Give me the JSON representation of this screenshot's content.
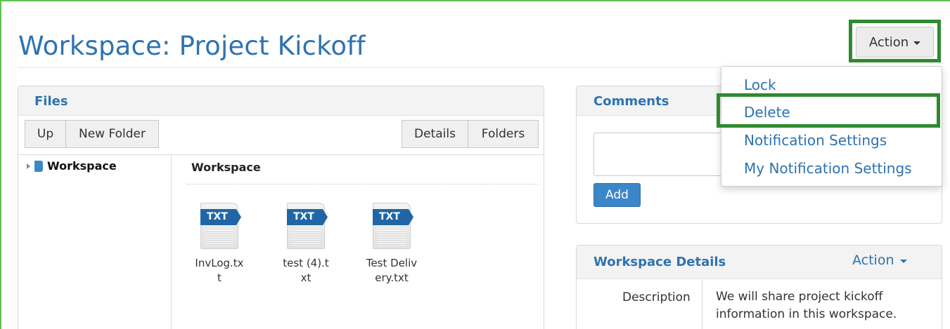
{
  "page": {
    "title": "Workspace: Project Kickoff",
    "action_label": "Action"
  },
  "action_menu": {
    "items": [
      "Lock",
      "Delete",
      "Notification Settings",
      "My Notification Settings"
    ]
  },
  "files": {
    "title": "Files",
    "toolbar": {
      "up": "Up",
      "new_folder": "New Folder",
      "details": "Details",
      "folders": "Folders"
    },
    "tree_root": "Workspace",
    "breadcrumb": "Workspace",
    "items": [
      {
        "type": "TXT",
        "name": "InvLog.txt"
      },
      {
        "type": "TXT",
        "name": "test (4).txt"
      },
      {
        "type": "TXT",
        "name": "Test Delivery.txt"
      }
    ]
  },
  "comments": {
    "title": "Comments",
    "add_label": "Add"
  },
  "workspace_details": {
    "title": "Workspace Details",
    "action_label": "Action",
    "description_label": "Description",
    "description_value": "We will share project kickoff information in this workspace."
  },
  "colors": {
    "link_blue": "#2e73b0",
    "highlight_green": "#2f8a2f",
    "frame_green": "#5cc452",
    "primary_button": "#3b86c8"
  },
  "icons": {
    "folder": "folder-icon",
    "tree_expand": "tree-expand-icon",
    "file": "txt-file-icon",
    "dropdown": "caret-down-icon"
  }
}
